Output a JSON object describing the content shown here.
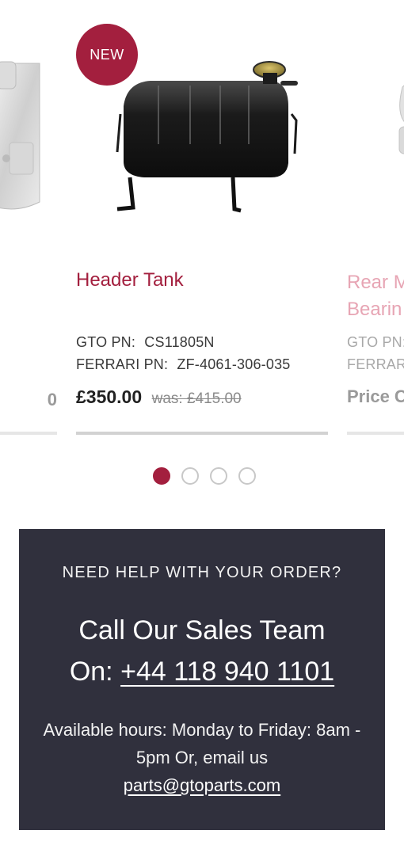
{
  "carousel": {
    "left_card": {
      "price_fragment": "0"
    },
    "center_card": {
      "badge": "NEW",
      "title": "Header Tank",
      "gto_pn_label": "GTO PN:",
      "gto_pn_value": "CS11805N",
      "ferrari_pn_label": "FERRARI PN:",
      "ferrari_pn_value": "ZF-4061-306-035",
      "price": "£350.00",
      "was_price": "was: £415.00"
    },
    "right_card": {
      "title_line1": "Rear M",
      "title_line2": "Bearin",
      "gto_pn_label": "GTO PN:",
      "ferrari_pn_label": "FERRARI",
      "price_fragment": "Price C"
    },
    "dots": {
      "count": 4,
      "active_index": 0
    }
  },
  "help": {
    "eyebrow": "NEED HELP WITH YOUR ORDER?",
    "headline_line1": "Call Our Sales Team",
    "headline_prefix": "On:",
    "phone": "+44 118 940 1101",
    "hours_text": "Available hours: Monday to Friday: 8am - 5pm Or, email us",
    "email": "parts@gtoparts.com"
  },
  "colors": {
    "brand": "#a31f3e",
    "help_bg": "#30303d"
  }
}
